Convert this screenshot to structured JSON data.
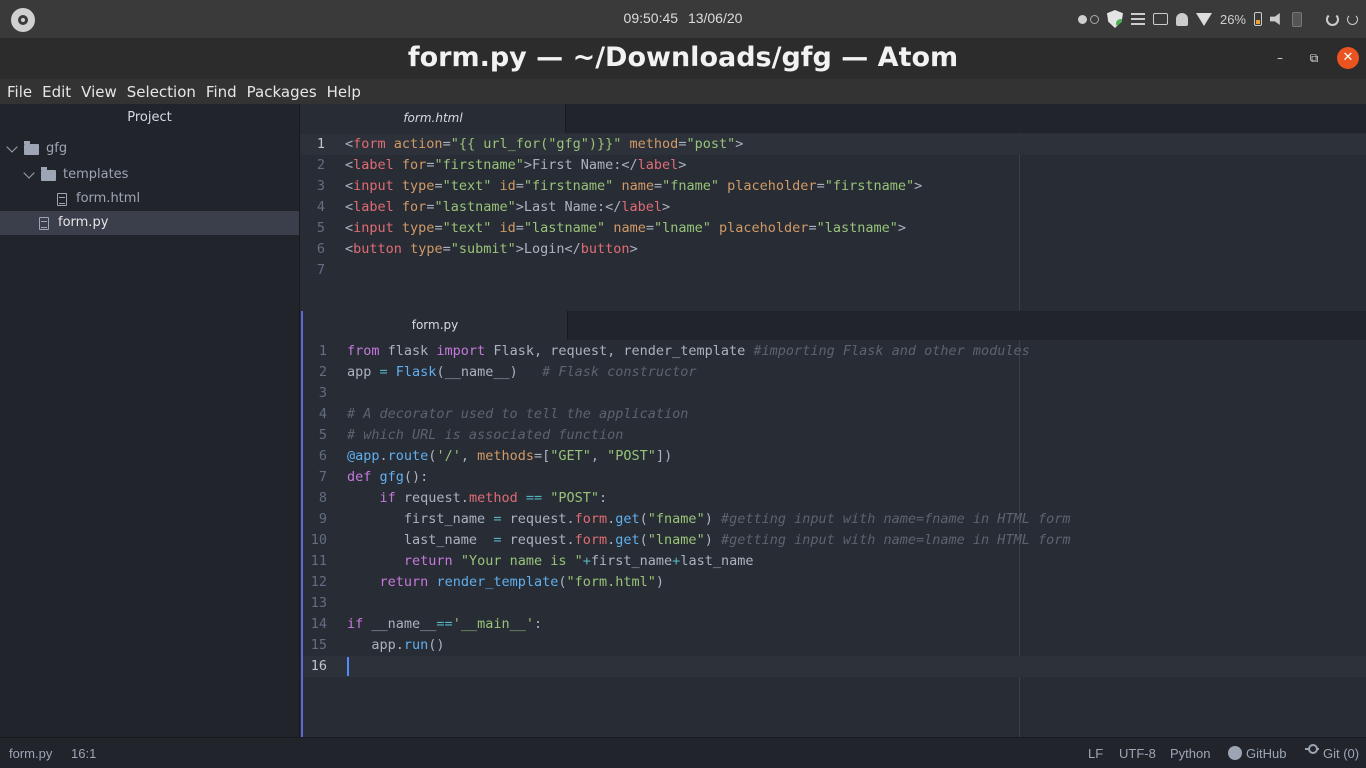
{
  "system": {
    "time": "09:50:45",
    "date": "13/06/20",
    "battery": "26%"
  },
  "window": {
    "title": "form.py — ~/Downloads/gfg — Atom",
    "minimize": "–",
    "maximize": "⧉",
    "close": "✕"
  },
  "menu": [
    "File",
    "Edit",
    "View",
    "Selection",
    "Find",
    "Packages",
    "Help"
  ],
  "tree": {
    "header": "Project",
    "root": "gfg",
    "templates_folder": "templates",
    "template_file": "form.html",
    "selected_file": "form.py"
  },
  "pane1": {
    "tab": "form.html",
    "line_numbers": [
      "1",
      "2",
      "3",
      "4",
      "5",
      "6",
      "7"
    ]
  },
  "pane2": {
    "tab": "form.py",
    "line_numbers": [
      "1",
      "2",
      "3",
      "4",
      "5",
      "6",
      "7",
      "8",
      "9",
      "10",
      "11",
      "12",
      "13",
      "14",
      "15",
      "16"
    ]
  },
  "status": {
    "file": "form.py",
    "cursor": "16:1",
    "line_ending": "LF",
    "encoding": "UTF-8",
    "grammar": "Python",
    "github": "GitHub",
    "git": "Git (0)"
  },
  "colors": {
    "keyword": "#c678dd",
    "string": "#98c379",
    "comment": "#5c6370",
    "function": "#61afef",
    "cursor": "#528bff",
    "close_button": "#e95420"
  }
}
